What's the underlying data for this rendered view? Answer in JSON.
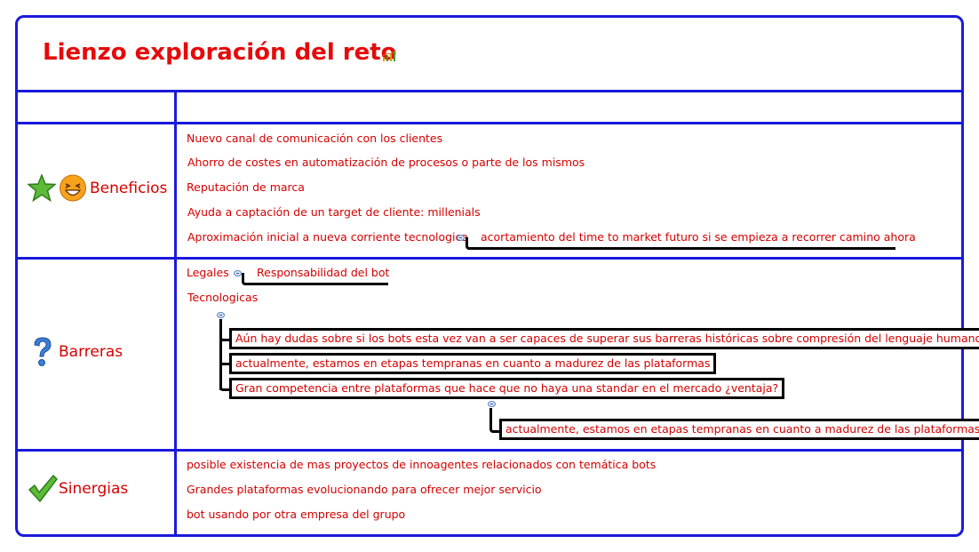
{
  "title": "Lienzo exploración del reto",
  "colors": {
    "border": "#1a1adb",
    "text": "#d40000",
    "title": "#e50b0b"
  },
  "icons": {
    "title": "chart-icon",
    "beneficios": [
      "star-icon",
      "laughing-face-icon"
    ],
    "barreras": "question-mark-icon",
    "sinergias": "checkmark-icon"
  },
  "sections": {
    "beneficios": {
      "label": "Beneficios",
      "items": [
        "Nuevo canal de comunicación con los clientes",
        "Ahorro de costes en automatización de procesos o parte de los mismos",
        "Reputación de marca",
        "Ayuda a captación de un target de cliente: millenials",
        "Aproximación inicial a nueva corriente tecnologica"
      ],
      "sub": "acortamiento del time to market futuro si se empieza a recorrer camino ahora"
    },
    "barreras": {
      "label": "Barreras",
      "legales": "Legales",
      "legales_sub": "Responsabilidad del bot",
      "tecnologicas": "Tecnologicas",
      "tec_subs": [
        "Aún hay dudas sobre si los bots esta vez van a ser capaces de superar sus barreras históricas sobre compresión del lenguaje humano.",
        "actualmente, estamos en etapas tempranas en cuanto a madurez de las plataformas",
        "Gran competencia entre plataformas que hace que no haya una standar en el mercado ¿ventaja?"
      ],
      "tec_subsub": "actualmente, estamos en etapas tempranas en cuanto a madurez de las plataformas"
    },
    "sinergias": {
      "label": "Sinergias",
      "items": [
        "posible existencia de mas proyectos de innoagentes relacionados con temática bots",
        "Grandes plataformas evolucionando para ofrecer mejor servicio",
        "bot usando por otra empresa del grupo"
      ]
    }
  }
}
